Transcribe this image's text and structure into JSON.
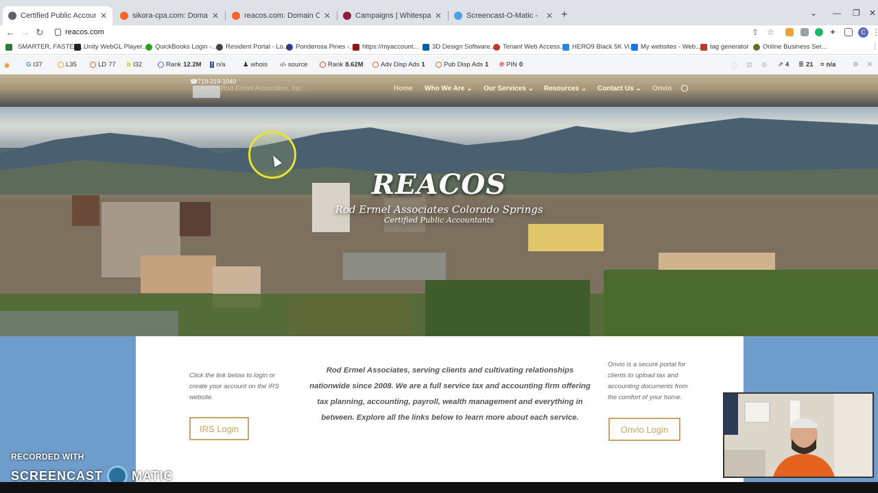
{
  "browser": {
    "tabs": [
      {
        "title": "Certified Public Accountants - C",
        "active": true,
        "icon_color": "#5f6368"
      },
      {
        "title": "sikora-cpa.com: Domain Overvie",
        "active": false,
        "icon_color": "#ff642d"
      },
      {
        "title": "reacos.com: Domain Overview",
        "active": false,
        "icon_color": "#ff642d"
      },
      {
        "title": "Campaigns | Whitespark Local C",
        "active": false,
        "icon_color": "#8b1e3f"
      },
      {
        "title": "Screencast-O-Matic -",
        "active": false,
        "icon_color": "#4aa3df"
      }
    ],
    "url": "reacos.com",
    "bookmarks": [
      {
        "label": "SMARTER, FASTER,...",
        "icon_color": "#2b7a3a"
      },
      {
        "label": "Unity WebGL Player...",
        "icon_color": "#222222"
      },
      {
        "label": "QuickBooks Login -...",
        "icon_color": "#2ca01c"
      },
      {
        "label": "Resident Portal - Lo...",
        "icon_color": "#444444"
      },
      {
        "label": "Ponderosa Pines -...",
        "icon_color": "#2a3d8f"
      },
      {
        "label": "https://myaccount...",
        "icon_color": "#8b1a1a"
      },
      {
        "label": "3D Design Software...",
        "icon_color": "#0a5ea8"
      },
      {
        "label": "Tenant Web Access...",
        "icon_color": "#c0392b"
      },
      {
        "label": "HERO9 Black 5K Vi...",
        "icon_color": "#2e86de"
      },
      {
        "label": "My websites - Web...",
        "icon_color": "#1a73e8"
      },
      {
        "label": "tag generator",
        "icon_color": "#c0392b"
      },
      {
        "label": "Online Business Ser...",
        "icon_color": "#6b6b2a"
      }
    ],
    "seo_bar": [
      {
        "label": "G",
        "value": "I37"
      },
      {
        "label": "",
        "value": "L35"
      },
      {
        "label": "LD",
        "value": "77"
      },
      {
        "label": "",
        "value": "I32"
      },
      {
        "label": "Rank",
        "value": "12.2M"
      },
      {
        "label": "",
        "value": "n/a"
      },
      {
        "label": "whois",
        "value": ""
      },
      {
        "label": "source",
        "value": ""
      },
      {
        "label": "Rank",
        "value": "8.62M"
      },
      {
        "label": "Adv Disp Ads",
        "value": "1"
      },
      {
        "label": "Pub Disp Ads",
        "value": "1"
      },
      {
        "label": "PIN",
        "value": "0"
      },
      {
        "label": "",
        "value": "4"
      },
      {
        "label": "",
        "value": "21"
      },
      {
        "label": "",
        "value": "n/a"
      }
    ]
  },
  "site": {
    "phone": "719-219-1040",
    "logo_text": "Rod Ermel Associates, Inc.",
    "menu": [
      {
        "label": "Home",
        "has_dropdown": false
      },
      {
        "label": "Who We Are",
        "has_dropdown": true
      },
      {
        "label": "Our Services",
        "has_dropdown": true
      },
      {
        "label": "Resources",
        "has_dropdown": true
      },
      {
        "label": "Contact Us",
        "has_dropdown": true
      },
      {
        "label": "Onvio",
        "has_dropdown": false
      }
    ],
    "hero": {
      "title": "REACOS",
      "subtitle": "Rod Ermel Associates Colorado Springs",
      "tagline": "Certified Public Accountants"
    },
    "left_text": "Click the link below to login or create your account on the IRS website.",
    "middle_text": "Rod Ermel Associates, serving clients and cultivating relationships nationwide since 2008. We are a full service tax and accounting firm offering tax planning, accounting, payroll, wealth management and everything in between. Explore all the links below to learn more about each service.",
    "right_text": "Onvio is a secure portal for clients to upload tax and accounting documents from the comfort of your home.",
    "irs_button": "IRS Login",
    "onvio_button": "Onvio Login"
  },
  "overlay": {
    "recorded_with": "RECORDED WITH",
    "brand_left": "SCREENCAST",
    "brand_right": "MATIC"
  },
  "colors": {
    "accent": "#c8a46a",
    "band": "#6e9ccb"
  }
}
